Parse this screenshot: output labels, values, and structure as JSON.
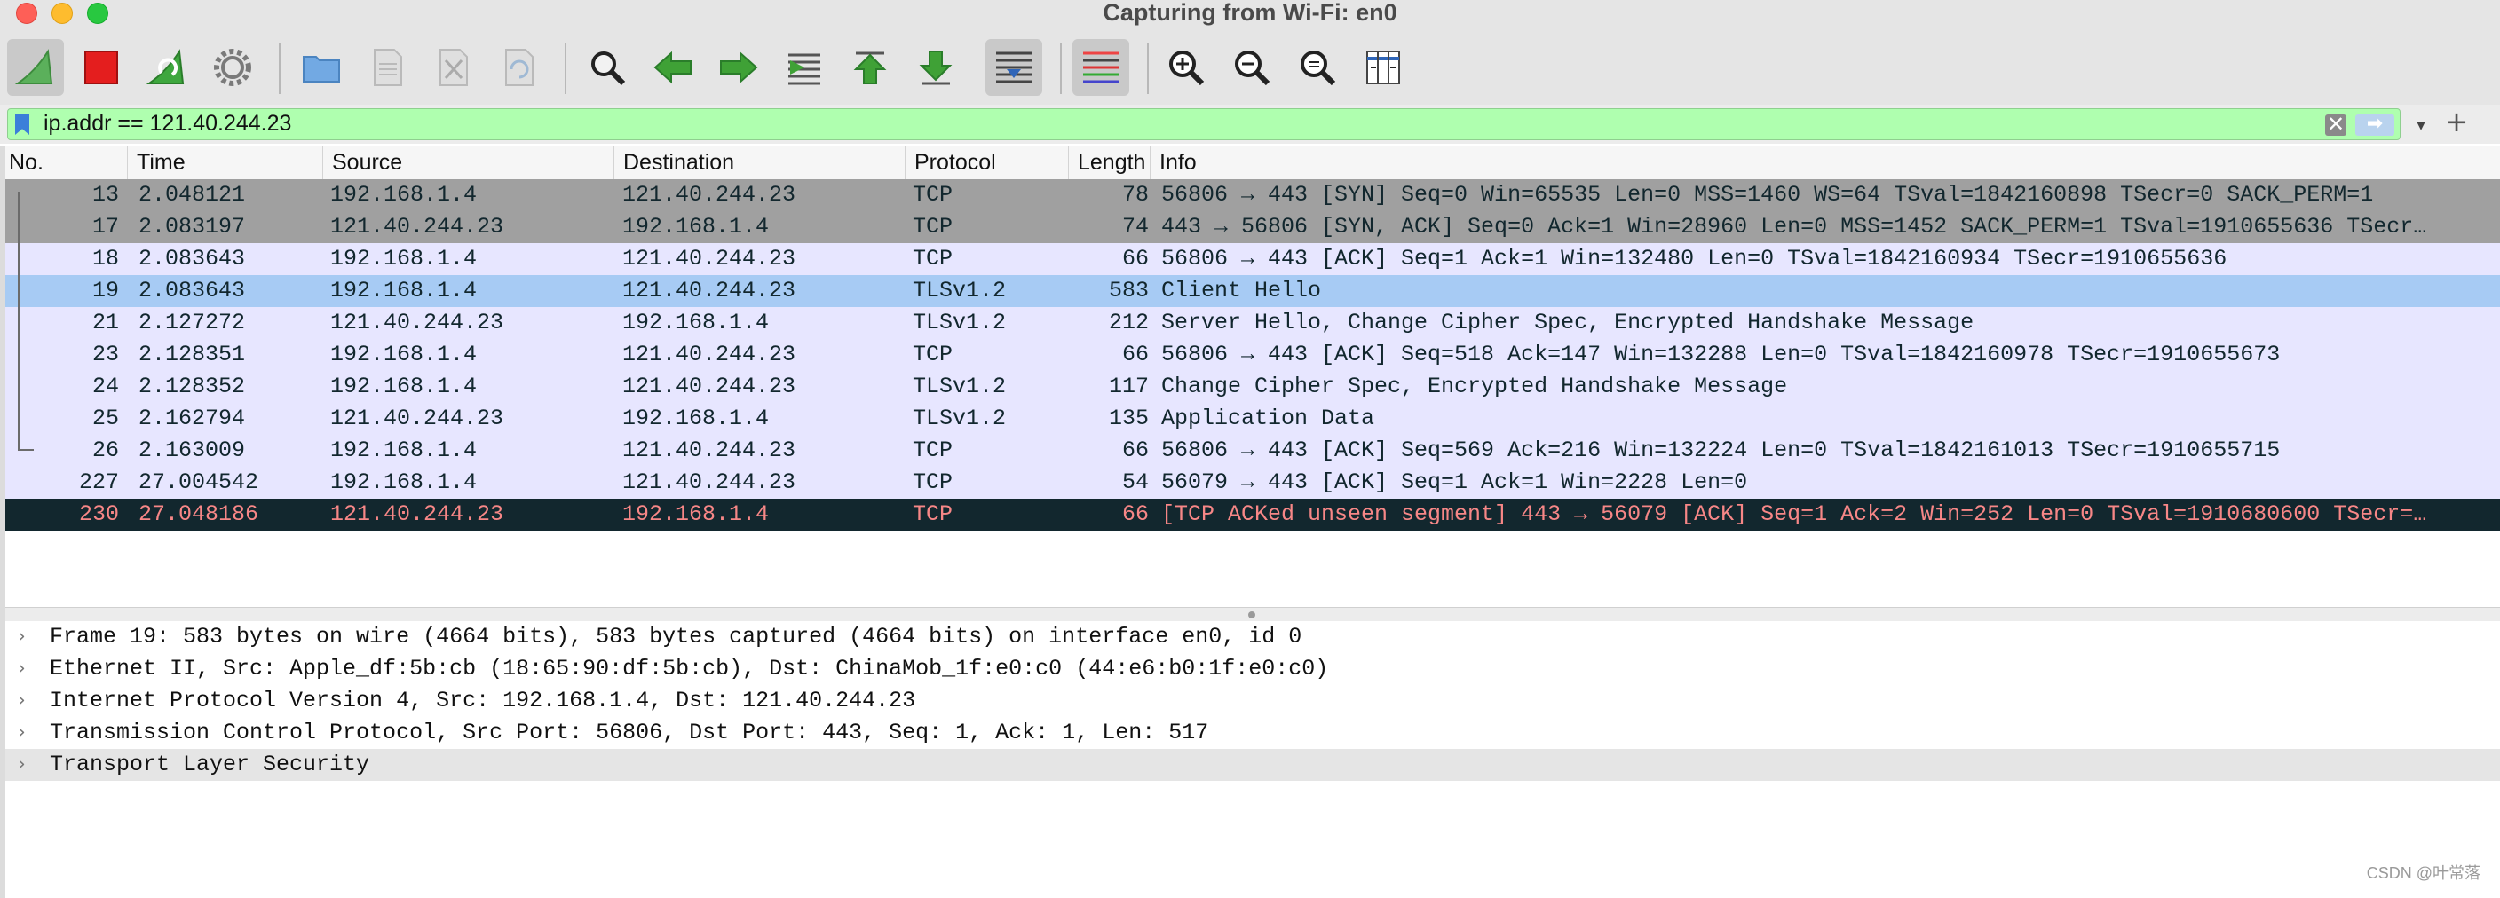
{
  "window": {
    "title": "Capturing from Wi-Fi: en0"
  },
  "toolbar": {
    "colors": {
      "fin": "#5bb05b",
      "stop": "#e41e1e",
      "restart": "#3ea73e",
      "folder": "#72a9e3",
      "arrow": "#3fa136",
      "gray": "#7a7a7a"
    }
  },
  "filter": {
    "value": "ip.addr == 121.40.244.23",
    "clear": "✕",
    "apply": "➡",
    "dropdown": "▾",
    "add": "+"
  },
  "columns": [
    "No.",
    "Time",
    "Source",
    "Destination",
    "Protocol",
    "Length",
    "Info"
  ],
  "packets": [
    {
      "no": "13",
      "time": "2.048121",
      "src": "192.168.1.4",
      "dst": "121.40.244.23",
      "proto": "TCP",
      "len": "78",
      "info": "56806 → 443 [SYN] Seq=0 Win=65535 Len=0 MSS=1460 WS=64 TSval=1842160898 TSecr=0 SACK_PERM=1"
    },
    {
      "no": "17",
      "time": "2.083197",
      "src": "121.40.244.23",
      "dst": "192.168.1.4",
      "proto": "TCP",
      "len": "74",
      "info": "443 → 56806 [SYN, ACK] Seq=0 Ack=1 Win=28960 Len=0 MSS=1452 SACK_PERM=1 TSval=1910655636 TSecr…"
    },
    {
      "no": "18",
      "time": "2.083643",
      "src": "192.168.1.4",
      "dst": "121.40.244.23",
      "proto": "TCP",
      "len": "66",
      "info": "56806 → 443 [ACK] Seq=1 Ack=1 Win=132480 Len=0 TSval=1842160934 TSecr=1910655636"
    },
    {
      "no": "19",
      "time": "2.083643",
      "src": "192.168.1.4",
      "dst": "121.40.244.23",
      "proto": "TLSv1.2",
      "len": "583",
      "info": "Client Hello"
    },
    {
      "no": "21",
      "time": "2.127272",
      "src": "121.40.244.23",
      "dst": "192.168.1.4",
      "proto": "TLSv1.2",
      "len": "212",
      "info": "Server Hello, Change Cipher Spec, Encrypted Handshake Message"
    },
    {
      "no": "23",
      "time": "2.128351",
      "src": "192.168.1.4",
      "dst": "121.40.244.23",
      "proto": "TCP",
      "len": "66",
      "info": "56806 → 443 [ACK] Seq=518 Ack=147 Win=132288 Len=0 TSval=1842160978 TSecr=1910655673"
    },
    {
      "no": "24",
      "time": "2.128352",
      "src": "192.168.1.4",
      "dst": "121.40.244.23",
      "proto": "TLSv1.2",
      "len": "117",
      "info": "Change Cipher Spec, Encrypted Handshake Message"
    },
    {
      "no": "25",
      "time": "2.162794",
      "src": "121.40.244.23",
      "dst": "192.168.1.4",
      "proto": "TLSv1.2",
      "len": "135",
      "info": "Application Data"
    },
    {
      "no": "26",
      "time": "2.163009",
      "src": "192.168.1.4",
      "dst": "121.40.244.23",
      "proto": "TCP",
      "len": "66",
      "info": "56806 → 443 [ACK] Seq=569 Ack=216 Win=132224 Len=0 TSval=1842161013 TSecr=1910655715"
    },
    {
      "no": "227",
      "time": "27.004542",
      "src": "192.168.1.4",
      "dst": "121.40.244.23",
      "proto": "TCP",
      "len": "54",
      "info": "56079 → 443 [ACK] Seq=1 Ack=1 Win=2228 Len=0"
    },
    {
      "no": "230",
      "time": "27.048186",
      "src": "121.40.244.23",
      "dst": "192.168.1.4",
      "proto": "TCP",
      "len": "66",
      "info": "[TCP ACKed unseen segment] 443 → 56079 [ACK] Seq=1 Ack=2 Win=252 Len=0 TSval=1910680600 TSecr=…"
    }
  ],
  "details": [
    "Frame 19: 583 bytes on wire (4664 bits), 583 bytes captured (4664 bits) on interface en0, id 0",
    "Ethernet II, Src: Apple_df:5b:cb (18:65:90:df:5b:cb), Dst: ChinaMob_1f:e0:c0 (44:e6:b0:1f:e0:c0)",
    "Internet Protocol Version 4, Src: 192.168.1.4, Dst: 121.40.244.23",
    "Transmission Control Protocol, Src Port: 56806, Dst Port: 443, Seq: 1, Ack: 1, Len: 517",
    "Transport Layer Security"
  ],
  "detail_chevron": "›",
  "watermark": "CSDN @叶常落"
}
